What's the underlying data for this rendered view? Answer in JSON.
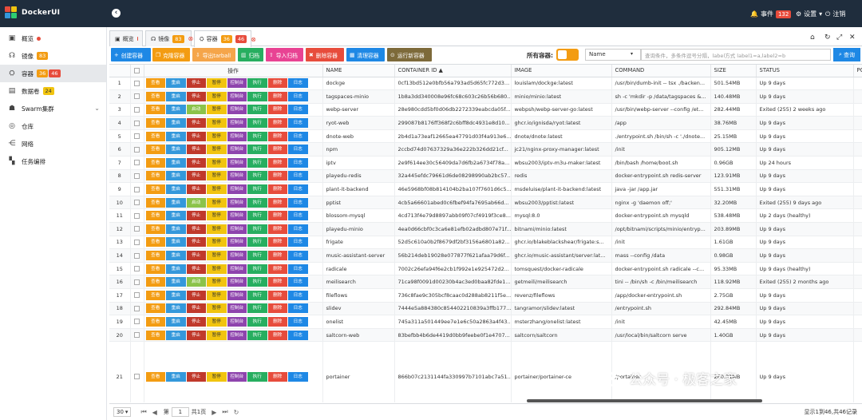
{
  "app": {
    "title": "DockerUI"
  },
  "topbar": {
    "events_label": "事件",
    "events_count": "132",
    "settings_label": "设置",
    "logout_label": "注销"
  },
  "colors": {
    "topbar": "#1f2d3d",
    "accent_blue": "#1e88e5",
    "orange": "#f39c12",
    "red": "#e74c3c"
  },
  "sidebar": {
    "items": [
      {
        "label": "概览",
        "icon": "monitor-icon"
      },
      {
        "label": "镜像",
        "icon": "headset-icon",
        "badge": "83"
      },
      {
        "label": "容器",
        "icon": "container-icon",
        "badge1": "36",
        "badge2": "46"
      },
      {
        "label": "数据卷",
        "icon": "disk-icon",
        "badge": "24"
      },
      {
        "label": "Swarm集群",
        "icon": "swarm-icon"
      },
      {
        "label": "仓库",
        "icon": "globe-icon"
      },
      {
        "label": "网络",
        "icon": "network-icon"
      },
      {
        "label": "任务编排",
        "icon": "grid-icon"
      }
    ]
  },
  "tabs": [
    {
      "label": "概览"
    },
    {
      "label": "镜像",
      "badge": "83"
    },
    {
      "label": "容器",
      "badge1": "36",
      "badge2": "46"
    }
  ],
  "toolbar": {
    "create": "创建容器",
    "clone": "克隆容器",
    "export": "导出tarball",
    "archive": "归档",
    "import_archive": "导入归档",
    "delete": "删除容器",
    "prune": "清理容器",
    "run_new": "运行新容器",
    "all_containers": "所有容器:",
    "select_value": "Name",
    "search_placeholder": "查询条件，多条件逗号分隔，label方式 label1=a,label2=b",
    "search_btn": "查询"
  },
  "ops": {
    "start": "查看",
    "restart": "重启",
    "stop": "停止",
    "on": "启动",
    "pause": "暂停",
    "console": "控制台",
    "exec": "执行",
    "del": "删除",
    "log": "日志"
  },
  "table": {
    "headers": {
      "ops": "操作",
      "name": "NAME",
      "id": "CONTAINER ID ▲",
      "image": "IMAGE",
      "command": "COMMAND",
      "size": "SIZE",
      "status": "STATUS",
      "ports": "PO"
    },
    "rows": [
      {
        "n": "1",
        "name": "dockge",
        "id": "0cf13bd512e0bfb56a793ad5d65fc772d3...",
        "image": "louislam/dockge:latest",
        "command": "/usr/bin/dumb-init -- tsx ./backen...",
        "size": "501.54MB",
        "status": "Up 9 days",
        "state": "up"
      },
      {
        "n": "2",
        "name": "tagspaces-minio",
        "id": "1b8a3dd340008e96fc68c603c26b56b680...",
        "image": "minio/minio:latest",
        "command": "sh -c 'mkdir -p /data/tagspaces &...",
        "size": "140.48MB",
        "status": "Up 9 days",
        "state": "up"
      },
      {
        "n": "3",
        "name": "webp-server",
        "id": "28e980cdd5bf0d06db2272339eabcda05f...",
        "image": "webpsh/webp-server-go:latest",
        "command": "/usr/bin/webp-server --config /et...",
        "size": "282.44MB",
        "status": "Exited (255) 2 weeks ago",
        "state": "ex"
      },
      {
        "n": "4",
        "name": "ryot-web",
        "id": "299087b8176ff368f2c6bff8dc4931e8d10...",
        "image": "ghcr.io/ignisda/ryot:latest",
        "command": "/app",
        "size": "38.76MB",
        "status": "Up 9 days",
        "state": "up"
      },
      {
        "n": "5",
        "name": "dnote-web",
        "id": "2b4d1a73eaf12665ea47791d03f4a913e6...",
        "image": "dnote/dnote:latest",
        "command": "./entrypoint.sh /bin/sh -c './dnote...",
        "size": "25.15MB",
        "status": "Up 9 days",
        "state": "up"
      },
      {
        "n": "6",
        "name": "npm",
        "id": "2ccbd74d07637329a36e222b326dd21cf...",
        "image": "jc21/nginx-proxy-manager:latest",
        "command": "/init",
        "size": "905.12MB",
        "status": "Up 9 days",
        "state": "up"
      },
      {
        "n": "7",
        "name": "iptv",
        "id": "2e9f614ee30c56409da7d6fb2a6734f78a...",
        "image": "wbsu2003/iptv-m3u-maker:latest",
        "command": "/bin/bash /home/boot.sh",
        "size": "0.96GB",
        "status": "Up 24 hours",
        "state": "up"
      },
      {
        "n": "8",
        "name": "playedu-redis",
        "id": "32a445efdc79661d6de08298990ab2bc57...",
        "image": "redis",
        "command": "docker-entrypoint.sh redis-server",
        "size": "123.91MB",
        "status": "Up 9 days",
        "state": "up"
      },
      {
        "n": "9",
        "name": "plant-it-backend",
        "id": "46e5968bf08b814104b2ba107f7601d6c5...",
        "image": "msdeluise/plant-it-backend:latest",
        "command": "java -jar /app.jar",
        "size": "551.31MB",
        "status": "Up 9 days",
        "state": "up"
      },
      {
        "n": "10",
        "name": "pptist",
        "id": "4cb5a66601abed0c6fbef94fa7695ab66d...",
        "image": "wbsu2003/pptist:latest",
        "command": "nginx -g 'daemon off;'",
        "size": "32.20MB",
        "status": "Exited (255) 9 days ago",
        "state": "ex"
      },
      {
        "n": "11",
        "name": "blossom-mysql",
        "id": "4cd713f4e79d8897abb09f07cf4919f3ce8...",
        "image": "mysql:8.0",
        "command": "docker-entrypoint.sh mysqld",
        "size": "538.48MB",
        "status": "Up 2 days (healthy)",
        "state": "up"
      },
      {
        "n": "12",
        "name": "playedu-minio",
        "id": "4ea0d66cbf0c3ca6e81efb02adbd807e71f...",
        "image": "bitnami/minio:latest",
        "command": "/opt/bitnami/scripts/minio/entryp...",
        "size": "203.89MB",
        "status": "Up 9 days",
        "state": "up"
      },
      {
        "n": "13",
        "name": "frigate",
        "id": "52d5c610a0b2f8679df2bf3156a6801a82...",
        "image": "ghcr.io/blakeblackshear/frigate:s...",
        "command": "/init",
        "size": "1.61GB",
        "status": "Up 9 days",
        "state": "up"
      },
      {
        "n": "14",
        "name": "music-assistant-server",
        "id": "56b214deb19028e077877f621afaa79d6f...",
        "image": "ghcr.io/music-assistant/server:lat...",
        "command": "mass --config /data",
        "size": "0.98GB",
        "status": "Up 9 days",
        "state": "up"
      },
      {
        "n": "15",
        "name": "radicale",
        "id": "7002c26efa94f6e2cb1f992e1e925472d2...",
        "image": "tomsquest/docker-radicale",
        "command": "docker-entrypoint.sh radicale --c...",
        "size": "95.33MB",
        "status": "Up 9 days (healthy)",
        "state": "up"
      },
      {
        "n": "16",
        "name": "meilisearch",
        "id": "71ca98f0091d00230b4ac3ed0baa82fde1...",
        "image": "getmeili/meilisearch",
        "command": "tini -- /bin/sh -c /bin/meilisearch",
        "size": "118.92MB",
        "status": "Exited (255) 2 months ago",
        "state": "ex"
      },
      {
        "n": "17",
        "name": "fileflows",
        "id": "736c8fae9c305bcf8caac0d288ab8211f5e...",
        "image": "revenz/fileflows",
        "command": "/app/docker-entrypoint.sh",
        "size": "2.75GB",
        "status": "Up 9 days",
        "state": "up"
      },
      {
        "n": "18",
        "name": "slidev",
        "id": "7444e5a884380c854402210839a3ffb177...",
        "image": "tangramor/slidev:latest",
        "command": "/entrypoint.sh",
        "size": "292.84MB",
        "status": "Up 9 days",
        "state": "up"
      },
      {
        "n": "19",
        "name": "onelist",
        "id": "745a311a501449ee7e1e6c50a2863a4f43...",
        "image": "msterzhang/onelist:latest",
        "command": "/init",
        "size": "42.45MB",
        "status": "Up 9 days",
        "state": "up"
      },
      {
        "n": "20",
        "name": "saltcorn-web",
        "id": "83befbb4b6de4419d0bb9feebe0f1e4707...",
        "image": "saltcorn/saltcorn",
        "command": "/usr/local/bin/saltcorn serve",
        "size": "1.40GB",
        "status": "Up 9 days",
        "state": "up"
      },
      {
        "n": "21",
        "name": "portainer",
        "id": "866b07c2131144fa330997b7101abc7a51...",
        "image": "portainer/portainer-ce",
        "command": "/portainer",
        "size": "260.31MB",
        "status": "Up 9 days",
        "state": "up"
      }
    ]
  },
  "footer": {
    "page_size": "30",
    "page_prefix": "第",
    "page_value": "1",
    "page_suffix": "共1页",
    "record_info": "显示1到46,共46记录"
  },
  "watermark": {
    "text": "公众号 · 极客之家"
  }
}
